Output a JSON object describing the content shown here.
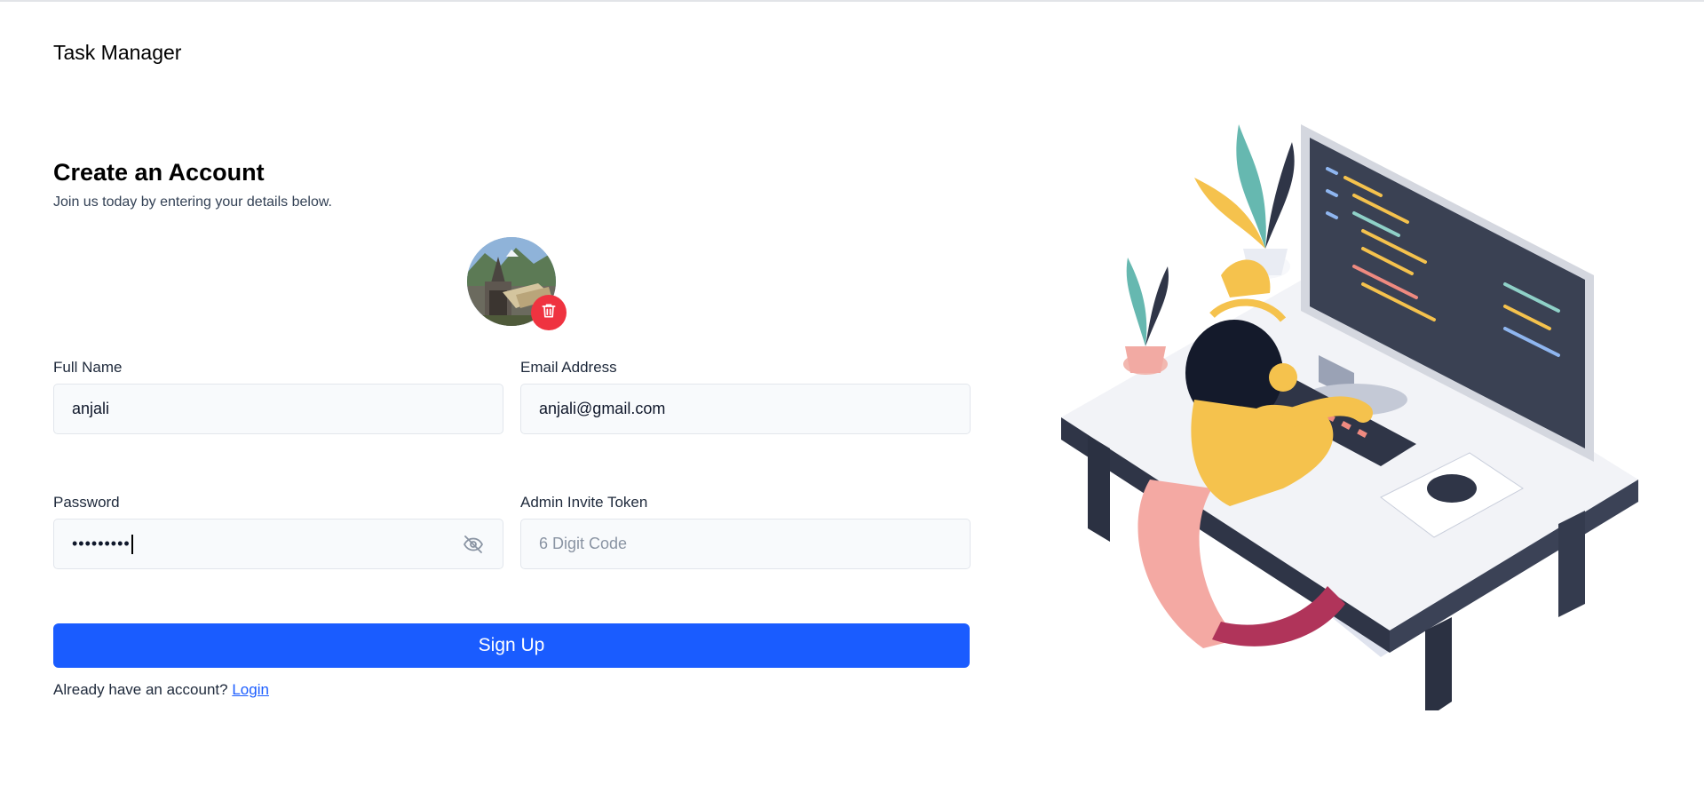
{
  "app": {
    "title": "Task Manager"
  },
  "form": {
    "heading": "Create an Account",
    "subheading": "Join us today by entering your details below.",
    "full_name": {
      "label": "Full Name",
      "value": "anjali"
    },
    "email": {
      "label": "Email Address",
      "value": "anjali@gmail.com"
    },
    "password": {
      "label": "Password",
      "masked_value": "•••••••••"
    },
    "admin_token": {
      "label": "Admin Invite Token",
      "placeholder": "6 Digit Code",
      "value": ""
    },
    "submit_label": "Sign Up",
    "footer_prompt": "Already have an account?",
    "footer_link": "Login"
  },
  "icons": {
    "delete": "trash-icon",
    "password_toggle": "eye-off-icon"
  },
  "colors": {
    "primary": "#1a5cff",
    "danger": "#ef3340",
    "input_bg": "#f8fafc"
  }
}
